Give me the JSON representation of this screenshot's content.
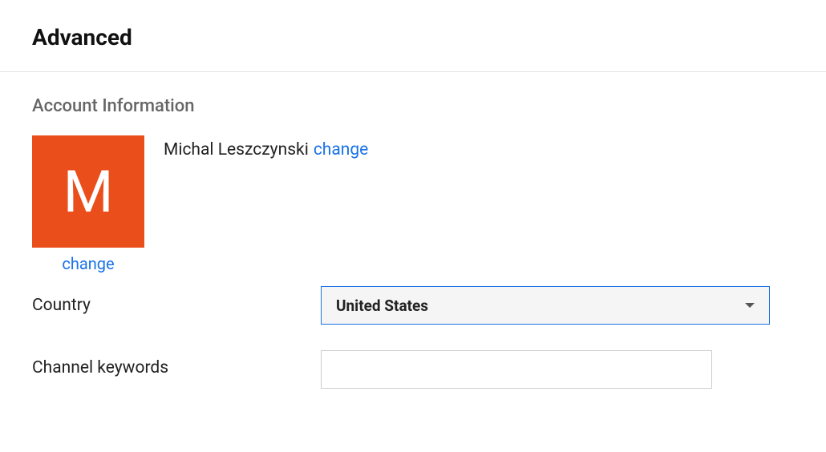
{
  "page": {
    "title": "Advanced"
  },
  "section": {
    "heading": "Account Information"
  },
  "account": {
    "avatar_initial": "M",
    "name": "Michal Leszczynski",
    "change_link_label": "change",
    "avatar_change_label": "change"
  },
  "form": {
    "country_label": "Country",
    "country_value": "United States",
    "keywords_label": "Channel keywords",
    "keywords_value": ""
  }
}
